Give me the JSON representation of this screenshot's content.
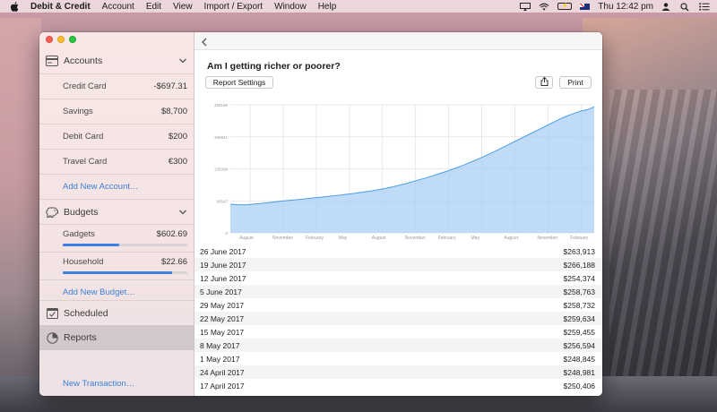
{
  "menubar": {
    "app_name": "Debit & Credit",
    "items": [
      "Account",
      "Edit",
      "View",
      "Import / Export",
      "Window",
      "Help"
    ],
    "clock": "Thu 12:42 pm",
    "icons": [
      "airplay-icon",
      "wifi-icon",
      "battery-icon",
      "flag-icon",
      "user-icon",
      "spotlight-icon",
      "list-icon"
    ]
  },
  "sidebar": {
    "accounts_label": "Accounts",
    "accounts": [
      {
        "name": "Credit Card",
        "value": "-$697.31"
      },
      {
        "name": "Savings",
        "value": "$8,700"
      },
      {
        "name": "Debit Card",
        "value": "$200"
      },
      {
        "name": "Travel Card",
        "value": "€300"
      }
    ],
    "add_account": "Add New Account…",
    "budgets_label": "Budgets",
    "budgets": [
      {
        "name": "Gadgets",
        "value": "$602.69",
        "progress": 0.45
      },
      {
        "name": "Household",
        "value": "$22.66",
        "progress": 0.88
      }
    ],
    "add_budget": "Add New Budget…",
    "scheduled_label": "Scheduled",
    "reports_label": "Reports",
    "new_transaction": "New Transaction…"
  },
  "report": {
    "title": "Am I getting richer or poorer?",
    "settings_button": "Report Settings",
    "print_button": "Print"
  },
  "colors": {
    "accent": "#3e7fe0",
    "link": "#3b82d6",
    "chart_fill": "#a9cff4",
    "chart_line": "#4a9ee8"
  },
  "chart_data": {
    "type": "area",
    "y_ticks": [
      "268188",
      "198841",
      "135099",
      "68547",
      "0"
    ],
    "x_ticks": [
      "August",
      "November",
      "February",
      "May",
      "August",
      "November",
      "February",
      "May",
      "August",
      "November",
      "February"
    ],
    "ylim": [
      0,
      268188
    ],
    "grid": true,
    "values": [
      60000,
      59000,
      58500,
      59500,
      61000,
      62000,
      64000,
      65500,
      67000,
      68500,
      69500,
      71000,
      72500,
      74000,
      75500,
      77000,
      78500,
      80500,
      82000,
      84000,
      86000,
      88000,
      90500,
      93000,
      96000,
      99500,
      103000,
      107000,
      111000,
      115000,
      119500,
      124000,
      128500,
      133500,
      138500,
      144000,
      150000,
      156000,
      162500,
      169000,
      176000,
      183000,
      190000,
      197000,
      204000,
      211000,
      218000,
      225000,
      232000,
      239000,
      245000,
      250000,
      255000,
      258000,
      263913
    ]
  },
  "table": {
    "rows": [
      {
        "date": "26 June 2017",
        "amount": "$263,913"
      },
      {
        "date": "19 June 2017",
        "amount": "$266,188"
      },
      {
        "date": "12 June 2017",
        "amount": "$254,374"
      },
      {
        "date": "5 June 2017",
        "amount": "$258,763"
      },
      {
        "date": "29 May 2017",
        "amount": "$258,732"
      },
      {
        "date": "22 May 2017",
        "amount": "$259,634"
      },
      {
        "date": "15 May 2017",
        "amount": "$259,455"
      },
      {
        "date": "8 May 2017",
        "amount": "$256,594"
      },
      {
        "date": "1 May 2017",
        "amount": "$248,845"
      },
      {
        "date": "24 April 2017",
        "amount": "$248,981"
      },
      {
        "date": "17 April 2017",
        "amount": "$250,406"
      }
    ]
  }
}
